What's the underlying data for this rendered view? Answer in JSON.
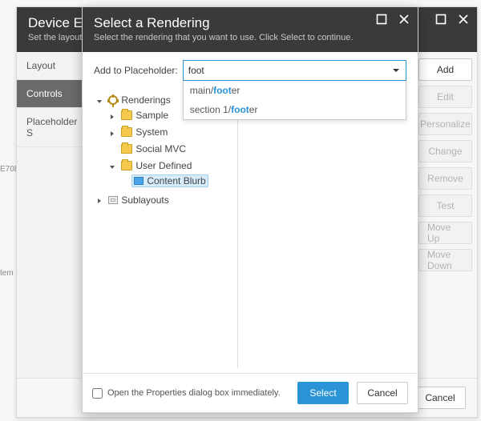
{
  "back": {
    "title": "Device Editor",
    "subtitle": "Set the layouts,",
    "tabs": {
      "layout": "Layout",
      "controls": "Controls",
      "placeholder": "Placeholder S"
    },
    "buttons": {
      "add": "Add",
      "edit": "Edit",
      "personalize": "Personalize",
      "change": "Change",
      "remove": "Remove",
      "test": "Test",
      "moveUp": "Move Up",
      "moveDown": "Move Down",
      "cancel": "Cancel"
    },
    "frag1": "E70E",
    "frag2": "tem"
  },
  "front": {
    "title": "Select a Rendering",
    "subtitle": "Select the rendering that you want to use. Click Select to continue.",
    "placeholderLabel": "Add to Placeholder:",
    "placeholderValue": "foot",
    "suggestions": [
      {
        "pre": "main/",
        "match": "foot",
        "post": "er"
      },
      {
        "pre": "section 1/",
        "match": "foot",
        "post": "er"
      }
    ],
    "tree": {
      "root": "Renderings",
      "folders": {
        "sample": "Sample",
        "system": "System",
        "social": "Social MVC",
        "user": "User Defined",
        "sub": "Sublayouts"
      },
      "items": {
        "contentBlurb": "Content Blurb"
      }
    },
    "openProps": "Open the Properties dialog box immediately.",
    "select": "Select",
    "cancel": "Cancel"
  }
}
